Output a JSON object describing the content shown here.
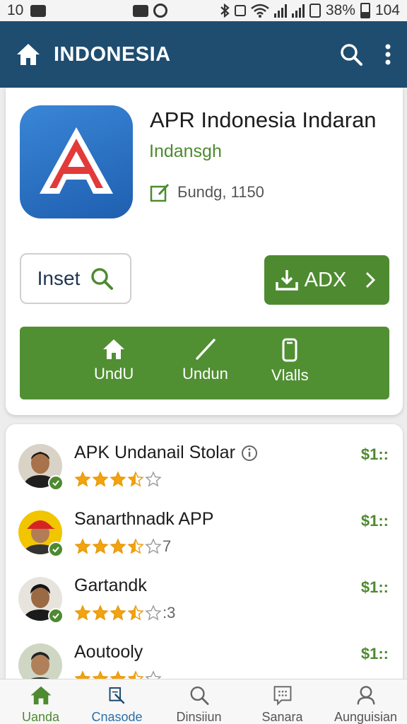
{
  "status_bar": {
    "time": "10",
    "battery": "38%",
    "right_number": "104"
  },
  "appbar": {
    "title": "INDONESIA",
    "home_icon": "home-icon",
    "search_icon": "search-icon",
    "menu_icon": "more-vert-icon"
  },
  "app": {
    "title": "APR Indonesia Indaran",
    "developer": "Indansgh",
    "meta": "Бundg, 1150",
    "colors": {
      "accent": "#4e8a30",
      "header": "#1e4d70",
      "icon_bg": "#2a72c4",
      "icon_letter": "#e23a3a"
    }
  },
  "buttons": {
    "inset_label": "Inset",
    "adx_label": "ADX"
  },
  "green_bar": {
    "items": [
      {
        "label": "UndU",
        "icon": "home-icon"
      },
      {
        "label": "Undun",
        "icon": "slash-icon"
      },
      {
        "label": "Vlalls",
        "icon": "phone-icon"
      }
    ]
  },
  "list": {
    "items": [
      {
        "title": "APK Undanail Stolar",
        "price": "$1::",
        "stars_full": 3.5,
        "stars_suffix": "",
        "has_info": true
      },
      {
        "title": "Sanarthnadk APP",
        "price": "$1::",
        "stars_full": 3.5,
        "stars_suffix": "7",
        "has_info": false
      },
      {
        "title": "Gartandk",
        "price": "$1::",
        "stars_full": 3.5,
        "stars_suffix": ":3",
        "has_info": false
      },
      {
        "title": "Aoutooly",
        "price": "$1::",
        "stars_full": 3.5,
        "stars_suffix": "",
        "has_info": false
      }
    ]
  },
  "bottom_nav": {
    "items": [
      {
        "label": "Uanda",
        "icon": "home-icon"
      },
      {
        "label": "Cnasode",
        "icon": "pencil-icon"
      },
      {
        "label": "Dinsiiun",
        "icon": "search-icon"
      },
      {
        "label": "Sanara",
        "icon": "chat-icon"
      },
      {
        "label": "Aunguisian",
        "icon": "person-icon"
      }
    ]
  }
}
